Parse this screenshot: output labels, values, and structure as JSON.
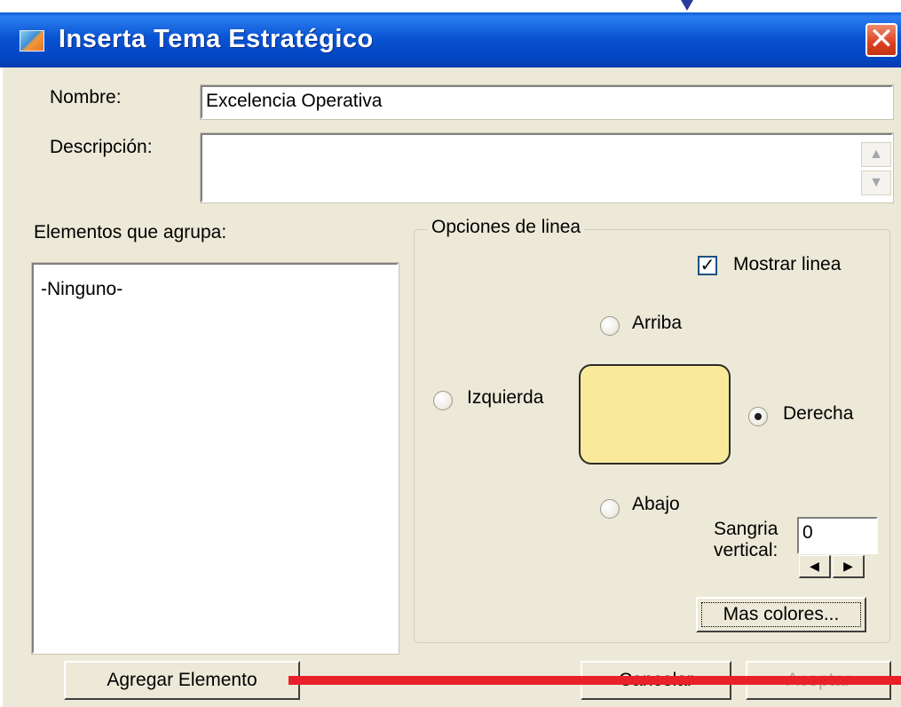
{
  "window": {
    "title": "Inserta Tema Estratégico",
    "icon": "app-icon",
    "close_icon": "close-icon",
    "close_glyph": "✕"
  },
  "form": {
    "nombre_label": "Nombre:",
    "nombre_value": "Excelencia Operativa",
    "descripcion_label": "Descripción:",
    "descripcion_value": "",
    "scroll_up_glyph": "▲",
    "scroll_down_glyph": "▼"
  },
  "elements": {
    "label": "Elementos que agrupa:",
    "items": [
      "-Ninguno-"
    ]
  },
  "line_options": {
    "legend": "Opciones de linea",
    "show_line_label": "Mostrar linea",
    "show_line_checked": true,
    "check_glyph": "✓",
    "radios": {
      "top": "Arriba",
      "left": "Izquierda",
      "right": "Derecha",
      "bottom": "Abajo"
    },
    "selected": "Derecha",
    "preview_color": "#f8ea9a",
    "indent_label_1": "Sangria",
    "indent_label_2": "vertical:",
    "indent_value": "0",
    "spin_left_glyph": "◀",
    "spin_right_glyph": "▶",
    "more_colors_label": "Mas colores..."
  },
  "buttons": {
    "add_element": "Agregar Elemento",
    "cancel": "Cancelar",
    "accept": "Aceptar"
  },
  "colors": {
    "titlebar": "#0954d3",
    "dialog_bg": "#ece9d8",
    "annotation_red": "#e8202a"
  }
}
